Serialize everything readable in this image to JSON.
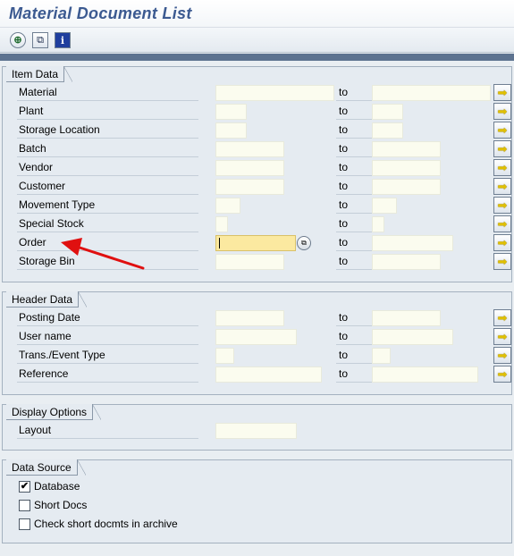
{
  "window": {
    "title": "Material Document List"
  },
  "toolbar": {
    "execute_icon": "execute-icon",
    "variant_icon": "get-variant-icon",
    "info_icon": "info-icon",
    "info_glyph": "i"
  },
  "item_data": {
    "title": "Item Data",
    "rows": [
      {
        "label": "Material",
        "low": "",
        "high": ""
      },
      {
        "label": "Plant",
        "low": "",
        "high": ""
      },
      {
        "label": "Storage Location",
        "low": "",
        "high": ""
      },
      {
        "label": "Batch",
        "low": "",
        "high": ""
      },
      {
        "label": "Vendor",
        "low": "",
        "high": ""
      },
      {
        "label": "Customer",
        "low": "",
        "high": ""
      },
      {
        "label": "Movement Type",
        "low": "",
        "high": ""
      },
      {
        "label": "Special Stock",
        "low": "",
        "high": ""
      },
      {
        "label": "Order",
        "low": "",
        "high": ""
      },
      {
        "label": "Storage Bin",
        "low": "",
        "high": ""
      }
    ]
  },
  "header_data": {
    "title": "Header Data",
    "rows": [
      {
        "label": "Posting Date",
        "low": "",
        "high": ""
      },
      {
        "label": "User name",
        "low": "",
        "high": ""
      },
      {
        "label": "Trans./Event Type",
        "low": "",
        "high": ""
      },
      {
        "label": "Reference",
        "low": "",
        "high": ""
      }
    ]
  },
  "display_options": {
    "title": "Display Options",
    "layout_label": "Layout",
    "layout_value": ""
  },
  "data_source": {
    "title": "Data Source",
    "options": [
      {
        "label": "Database",
        "checked": true
      },
      {
        "label": "Short Docs",
        "checked": false
      },
      {
        "label": "Check short docmts in archive",
        "checked": false
      }
    ]
  },
  "common": {
    "to_label": "to"
  },
  "colors": {
    "annotation_arrow": "#e01010",
    "focus_field": "#fbe9a0",
    "section_bar": "#5d7390"
  }
}
